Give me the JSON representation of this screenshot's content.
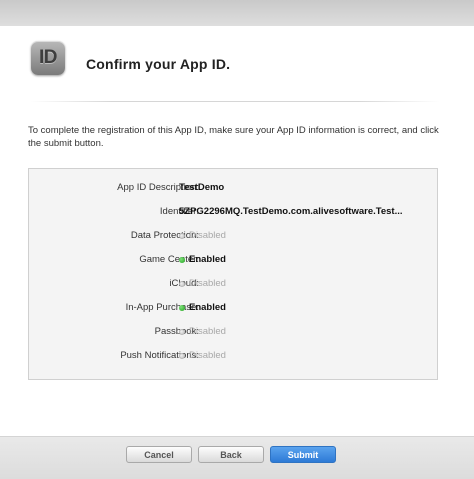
{
  "header": {
    "icon_text": "ID",
    "title": "Confirm your App ID."
  },
  "intro_text": "To complete the registration of this App ID, make sure your App ID information is correct, and click the submit button.",
  "details": {
    "description": {
      "label": "App ID Description:",
      "value": "TestDemo"
    },
    "identifier": {
      "label": "Identifier:",
      "value": "5ZPG2296MQ.TestDemo.com.alivesoftware.Test..."
    },
    "services": [
      {
        "label": "Data Protection:",
        "status": "Disabled",
        "enabled": false
      },
      {
        "label": "Game Center:",
        "status": "Enabled",
        "enabled": true
      },
      {
        "label": "iCloud:",
        "status": "Disabled",
        "enabled": false
      },
      {
        "label": "In-App Purchase:",
        "status": "Enabled",
        "enabled": true
      },
      {
        "label": "Passbook:",
        "status": "Disabled",
        "enabled": false
      },
      {
        "label": "Push Notifications:",
        "status": "Disabled",
        "enabled": false
      }
    ]
  },
  "footer": {
    "cancel_label": "Cancel",
    "back_label": "Back",
    "submit_label": "Submit"
  },
  "colors": {
    "enabled_dot": "#22a51f",
    "disabled_dot": "#c2c2c2",
    "primary_button": "#2d7ad6"
  }
}
